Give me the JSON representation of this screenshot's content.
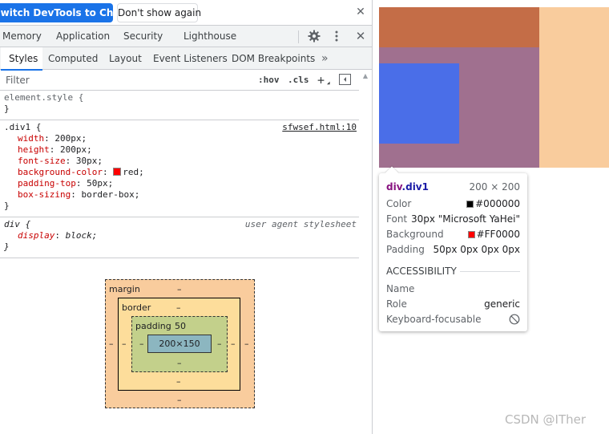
{
  "banner": {
    "switch_label": "Switch DevTools to Chinese",
    "dont_show_label": "Don't show again",
    "close_icon": "close-icon"
  },
  "main_tabs": [
    "Memory",
    "Application",
    "Security",
    "Lighthouse"
  ],
  "toolbar_icons": [
    "gear-icon",
    "kebab-menu-icon",
    "close-icon"
  ],
  "sub_tabs": [
    "Styles",
    "Computed",
    "Layout",
    "Event Listeners",
    "DOM Breakpoints"
  ],
  "sub_tabs_active": "Styles",
  "sub_tabs_more": "»",
  "filter": {
    "placeholder": "Filter",
    "hov": ":hov",
    "cls": ".cls",
    "add": "+",
    "toggle_icon": "sidebar-toggle-icon"
  },
  "rules": {
    "element_style": {
      "selector": "element.style {",
      "close": "}"
    },
    "div1": {
      "selector": ".div1 {",
      "source": "sfwsef.html:10",
      "decls": [
        {
          "prop": "width",
          "value": "200px;"
        },
        {
          "prop": "height",
          "value": "200px;"
        },
        {
          "prop": "font-size",
          "value": "30px;"
        },
        {
          "prop": "background-color",
          "value": "red;",
          "swatch": "#ff0000"
        },
        {
          "prop": "padding-top",
          "value": "50px;"
        },
        {
          "prop": "box-sizing",
          "value": "border-box;"
        }
      ],
      "close": "}"
    },
    "div_ua": {
      "selector": "div {",
      "source": "user agent stylesheet",
      "decls": [
        {
          "prop": "display",
          "value": "block;"
        }
      ],
      "close": "}"
    }
  },
  "box_model": {
    "margin_label": "margin",
    "margin": {
      "top": "–",
      "right": "–",
      "bottom": "–",
      "left": "–"
    },
    "border_label": "border",
    "border": {
      "top": "–",
      "right": "–",
      "bottom": "–",
      "left": "–"
    },
    "padding_label": "padding",
    "padding": {
      "top": "50",
      "right": "–",
      "bottom": "–",
      "left": "–"
    },
    "content": "200×150",
    "colors": {
      "margin": "#f9cc9d",
      "border": "#fddd9b",
      "padding": "#c3d08b",
      "content": "#8cb6c0"
    }
  },
  "page": {
    "colors": {
      "margin": "#f9cc9d",
      "padding_overlay": "#c46d47",
      "content_overlay": "#a0708f",
      "inner_block": "#4a6ee8"
    },
    "watermark": "CSDN @ITher"
  },
  "tooltip": {
    "tag": "div",
    "class": ".div1",
    "size": "200 × 200",
    "rows": [
      {
        "label": "Color",
        "value": "#000000",
        "swatch": "#000000"
      },
      {
        "label": "Font",
        "value": "30px \"Microsoft YaHei\""
      },
      {
        "label": "Background",
        "value": "#FF0000",
        "swatch": "#ff0000"
      },
      {
        "label": "Padding",
        "value": "50px 0px 0px 0px"
      }
    ],
    "accessibility_heading": "ACCESSIBILITY",
    "a11y_rows": [
      {
        "label": "Name",
        "value": ""
      },
      {
        "label": "Role",
        "value": "generic"
      },
      {
        "label": "Keyboard-focusable",
        "value": "",
        "icon": "not-allowed-icon"
      }
    ]
  }
}
